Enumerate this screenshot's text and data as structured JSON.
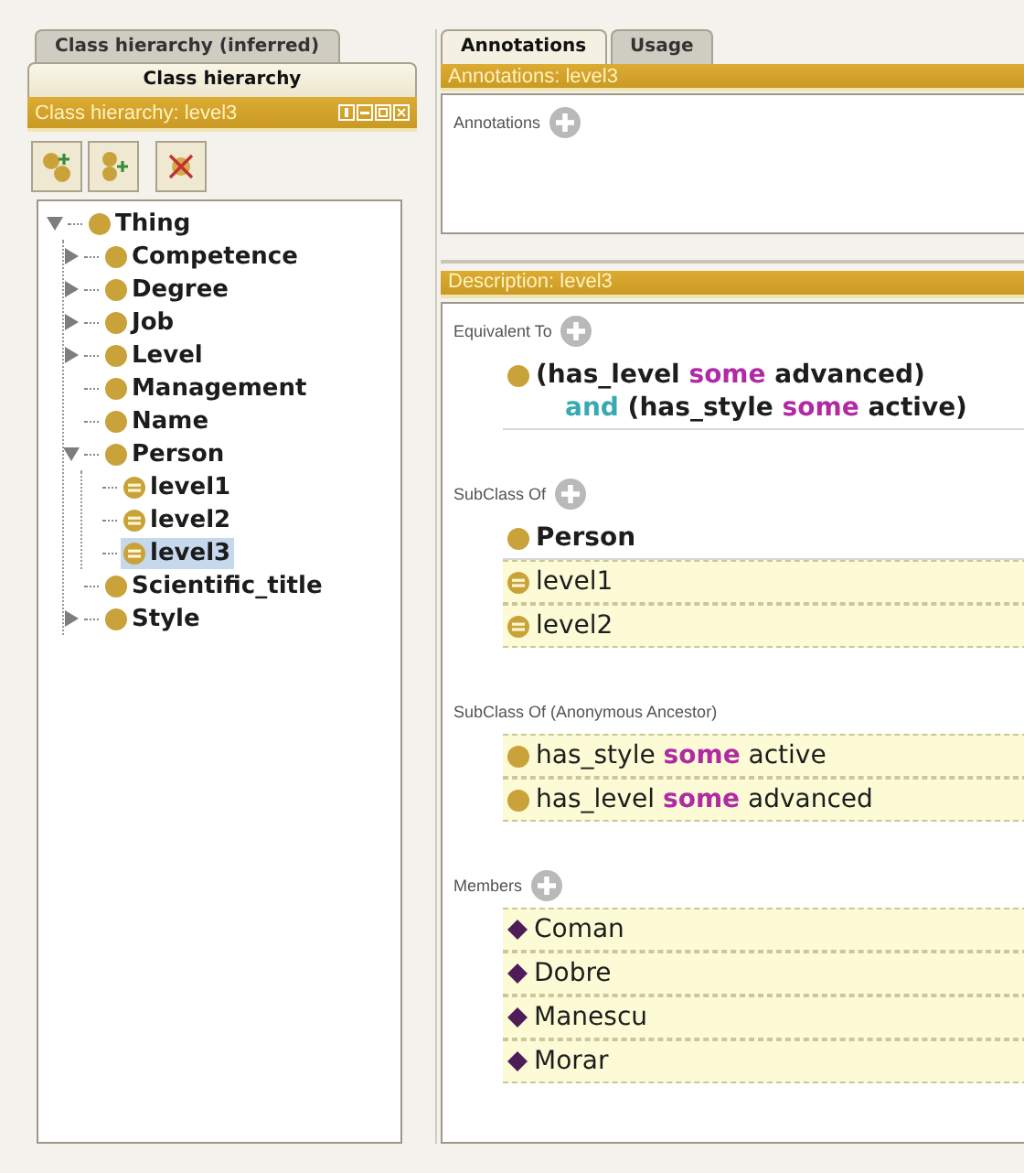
{
  "left_panel": {
    "tabs": [
      {
        "label": "Class hierarchy (inferred)",
        "selected": false
      },
      {
        "label": "Class hierarchy",
        "selected": true
      }
    ],
    "view_title": "Class hierarchy: level3",
    "tree": {
      "label": "Thing",
      "kind": "primitive",
      "expanded": true,
      "selected": false,
      "children": [
        {
          "label": "Competence",
          "kind": "primitive",
          "expanded": false,
          "selected": false
        },
        {
          "label": "Degree",
          "kind": "primitive",
          "expanded": false,
          "selected": false
        },
        {
          "label": "Job",
          "kind": "primitive",
          "expanded": false,
          "selected": false
        },
        {
          "label": "Level",
          "kind": "primitive",
          "expanded": false,
          "selected": false
        },
        {
          "label": "Management",
          "kind": "primitive",
          "selected": false
        },
        {
          "label": "Name",
          "kind": "primitive",
          "selected": false
        },
        {
          "label": "Person",
          "kind": "primitive",
          "expanded": true,
          "selected": false,
          "children": [
            {
              "label": "level1",
              "kind": "defined",
              "selected": false
            },
            {
              "label": "level2",
              "kind": "defined",
              "selected": false
            },
            {
              "label": "level3",
              "kind": "defined",
              "selected": true
            }
          ]
        },
        {
          "label": "Scientific_title",
          "kind": "primitive",
          "selected": false
        },
        {
          "label": "Style",
          "kind": "primitive",
          "expanded": false,
          "selected": false
        }
      ]
    }
  },
  "right_panel": {
    "tabs": [
      {
        "label": "Annotations",
        "selected": true
      },
      {
        "label": "Usage",
        "selected": false
      }
    ],
    "annotations_view": {
      "title": "Annotations: level3",
      "sections": [
        {
          "label": "Annotations",
          "addable": true
        }
      ]
    },
    "description_view": {
      "title": "Description: level3",
      "sections": [
        {
          "label": "Equivalent To",
          "addable": true,
          "entries": [
            {
              "kind": "primitive",
              "inferred": false,
              "lines": [
                [
                  {
                    "text": "(has_level ",
                    "kind": "name"
                  },
                  {
                    "text": "some",
                    "kind": "quantifier"
                  },
                  {
                    "text": " advanced)",
                    "kind": "name"
                  }
                ],
                [
                  {
                    "text": "and",
                    "kind": "connective"
                  },
                  {
                    "text": " (has_style ",
                    "kind": "name"
                  },
                  {
                    "text": "some",
                    "kind": "quantifier"
                  },
                  {
                    "text": " active)",
                    "kind": "name"
                  }
                ]
              ]
            }
          ]
        },
        {
          "label": "SubClass Of",
          "addable": true,
          "entries": [
            {
              "kind": "primitive",
              "inferred": false,
              "lines": [
                [
                  {
                    "text": "Person",
                    "kind": "name"
                  }
                ]
              ]
            },
            {
              "kind": "defined",
              "inferred": true,
              "lines": [
                [
                  {
                    "text": "level1",
                    "kind": "name"
                  }
                ]
              ]
            },
            {
              "kind": "defined",
              "inferred": true,
              "lines": [
                [
                  {
                    "text": "level2",
                    "kind": "name"
                  }
                ]
              ]
            }
          ]
        },
        {
          "label": "SubClass Of (Anonymous Ancestor)",
          "addable": false,
          "entries": [
            {
              "kind": "primitive",
              "inferred": true,
              "lines": [
                [
                  {
                    "text": "has_style ",
                    "kind": "name"
                  },
                  {
                    "text": "some",
                    "kind": "quantifier"
                  },
                  {
                    "text": " active",
                    "kind": "name"
                  }
                ]
              ]
            },
            {
              "kind": "primitive",
              "inferred": true,
              "lines": [
                [
                  {
                    "text": "has_level ",
                    "kind": "name"
                  },
                  {
                    "text": "some",
                    "kind": "quantifier"
                  },
                  {
                    "text": " advanced",
                    "kind": "name"
                  }
                ]
              ]
            }
          ]
        },
        {
          "label": "Members",
          "addable": true,
          "entries": [
            {
              "kind": "individual",
              "inferred": true,
              "lines": [
                [
                  {
                    "text": "Coman",
                    "kind": "name"
                  }
                ]
              ]
            },
            {
              "kind": "individual",
              "inferred": true,
              "lines": [
                [
                  {
                    "text": "Dobre",
                    "kind": "name"
                  }
                ]
              ]
            },
            {
              "kind": "individual",
              "inferred": true,
              "lines": [
                [
                  {
                    "text": "Manescu",
                    "kind": "name"
                  }
                ]
              ]
            },
            {
              "kind": "individual",
              "inferred": true,
              "lines": [
                [
                  {
                    "text": "Morar",
                    "kind": "name"
                  }
                ]
              ]
            }
          ]
        }
      ]
    }
  }
}
